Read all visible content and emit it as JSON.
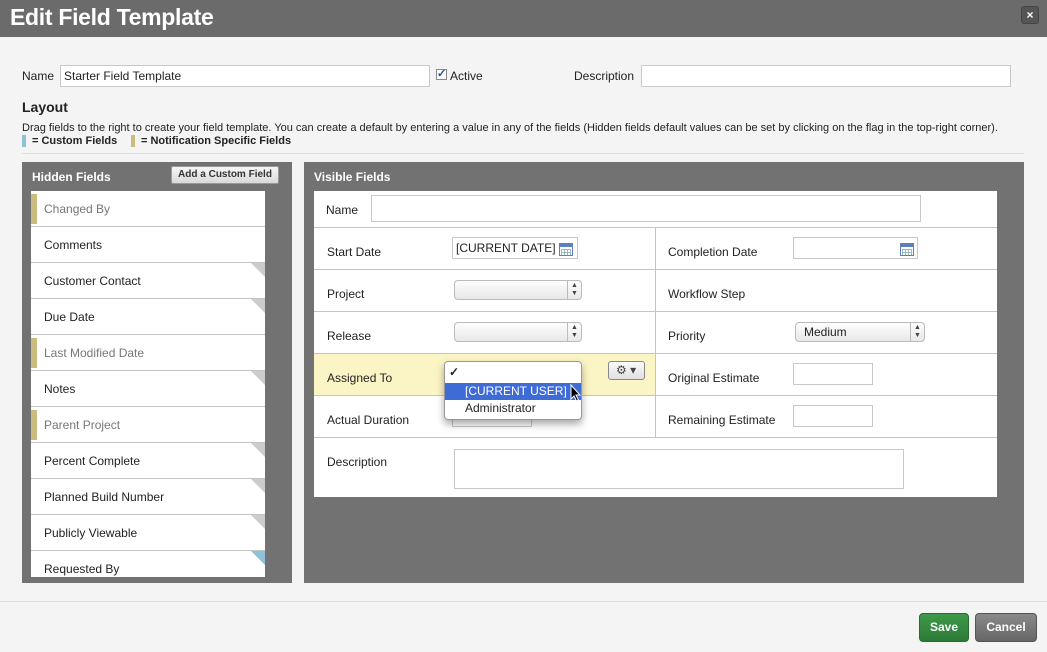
{
  "dialog": {
    "title": "Edit Field Template",
    "close_label": "×"
  },
  "header": {
    "name_label": "Name",
    "name_value": "Starter Field Template",
    "active_label": "Active",
    "active_checked": true,
    "description_label": "Description",
    "description_value": ""
  },
  "layout": {
    "title": "Layout",
    "help": "Drag fields to the right to create your field template. You can create a default by entering a value in any of the fields (Hidden fields default values can be set by clicking on the flag in the top-right corner).",
    "legend_custom": "= Custom Fields",
    "legend_notification": "= Notification Specific Fields",
    "colors": {
      "custom": "#8fc2d6",
      "notification": "#c9bc7e"
    }
  },
  "hidden_panel": {
    "title": "Hidden Fields",
    "add_button": "Add a Custom Field",
    "items": [
      {
        "label": "Changed By",
        "kind": "notification",
        "flag": "none"
      },
      {
        "label": "Comments",
        "kind": "normal",
        "flag": "none"
      },
      {
        "label": "Customer Contact",
        "kind": "normal",
        "flag": "grey"
      },
      {
        "label": "Due Date",
        "kind": "normal",
        "flag": "grey"
      },
      {
        "label": "Last Modified Date",
        "kind": "notification",
        "flag": "none"
      },
      {
        "label": "Notes",
        "kind": "normal",
        "flag": "grey"
      },
      {
        "label": "Parent Project",
        "kind": "notification",
        "flag": "none"
      },
      {
        "label": "Percent Complete",
        "kind": "normal",
        "flag": "grey"
      },
      {
        "label": "Planned Build Number",
        "kind": "normal",
        "flag": "grey"
      },
      {
        "label": "Publicly Viewable",
        "kind": "normal",
        "flag": "grey"
      },
      {
        "label": "Requested By",
        "kind": "normal",
        "flag": "blue"
      }
    ]
  },
  "visible_panel": {
    "title": "Visible Fields",
    "name_label": "Name",
    "start_date_label": "Start Date",
    "start_date_value": "[CURRENT DATE]",
    "completion_date_label": "Completion Date",
    "project_label": "Project",
    "workflow_step_label": "Workflow Step",
    "release_label": "Release",
    "priority_label": "Priority",
    "priority_value": "Medium",
    "assigned_to_label": "Assigned To",
    "original_estimate_label": "Original Estimate",
    "actual_duration_label": "Actual Duration",
    "remaining_estimate_label": "Remaining Estimate",
    "description_label": "Description",
    "gear_label": "⚙ ▾"
  },
  "assigned_dropdown": {
    "options": [
      "",
      "[CURRENT USER]",
      "Administrator"
    ],
    "checkmark": "✓",
    "highlighted_index": 1
  },
  "footer": {
    "save": "Save",
    "cancel": "Cancel"
  }
}
